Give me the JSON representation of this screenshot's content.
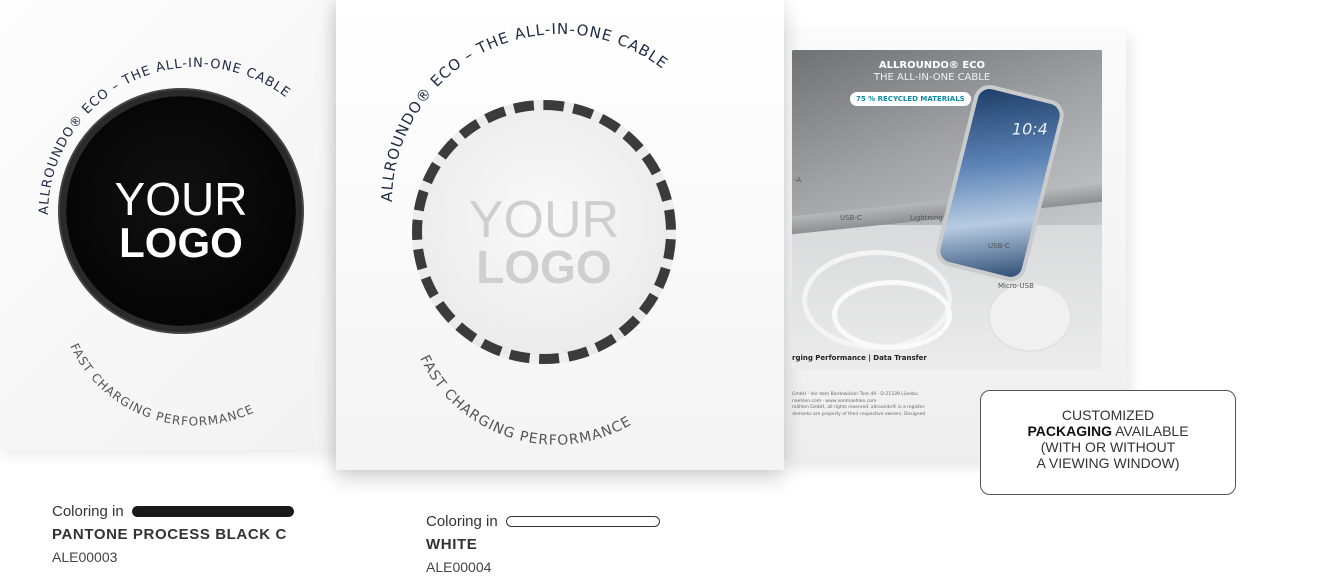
{
  "left_card": {
    "ring_top": "ALLROUNDO® ECO – THE ALL-IN-ONE CABLE",
    "ring_bottom": "FAST CHARGING PERFORMANCE",
    "logo_line1": "YOUR",
    "logo_line2": "LOGO",
    "disc_color": "#0a0a0a"
  },
  "center_card": {
    "ring_top": "ALLROUNDO® ECO – THE ALL-IN-ONE CABLE",
    "ring_bottom": "FAST CHARGING PERFORMANCE",
    "logo_line1": "YOUR",
    "logo_line2": "LOGO",
    "disc_color": "#eeeeee"
  },
  "insert_card": {
    "title": "ALLROUNDO® ECO",
    "subtitle": "THE ALL-IN-ONE CABLE",
    "badge": "75 % RECYCLED MATERIALS",
    "phone_time": "10:4",
    "labels": {
      "usb_a": "-A",
      "usb_c_1": "USB-C",
      "lightning": "Lightning",
      "usb_c_2": "USB-C",
      "micro_usb": "Micro-USB"
    },
    "footer": "rging Performance | Data Transfer",
    "legal": [
      "GmbH · Vor dem Bardowicker Tore 49 · D-21339 Lünebu",
      "naehlen.com · www.vonmaehlen.com",
      "mählen GmbH, all rights reserved. allroundo® is a register",
      "demarks are property of their respective owners. Designed"
    ]
  },
  "callout": {
    "line1": "CUSTOMIZED",
    "line2_bold": "PACKAGING",
    "line2_rest": " AVAILABLE",
    "line3": "(WITH OR WITHOUT",
    "line4": "A VIEWING WINDOW)"
  },
  "variants": [
    {
      "coloring_label": "Coloring in",
      "swatch_color": "#1a1a1a",
      "name": "PANTONE PROCESS BLACK C",
      "code": "ALE00003"
    },
    {
      "coloring_label": "Coloring in",
      "swatch_color": "#ffffff",
      "name": "WHITE",
      "code": "ALE00004"
    }
  ]
}
